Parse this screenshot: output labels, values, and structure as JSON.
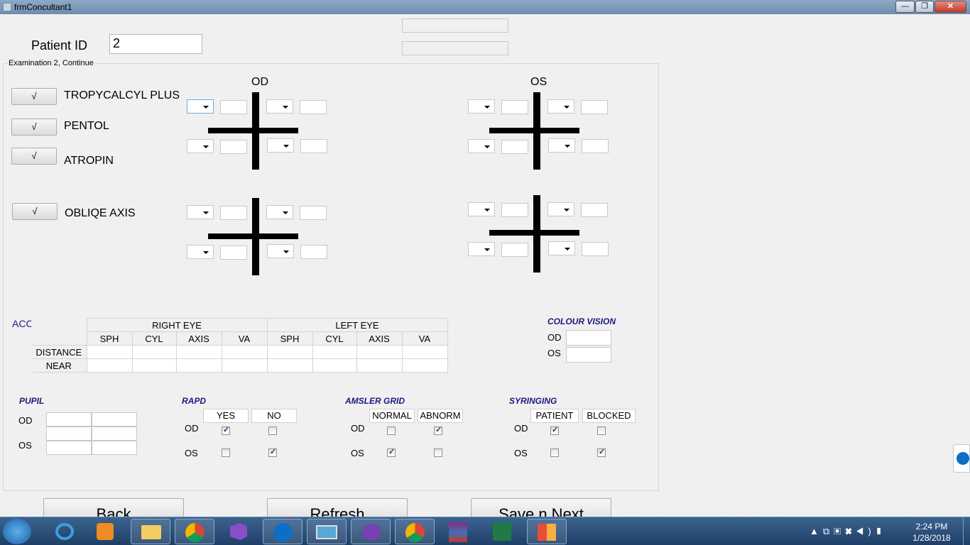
{
  "window": {
    "title": "frmConcultant1",
    "min": "—",
    "max": "❐",
    "close": "✕"
  },
  "patient": {
    "label": "Patient ID",
    "value": "2"
  },
  "group_label": "Examination 2, Continue",
  "od_label": "OD",
  "os_label": "OS",
  "drugs": [
    {
      "check": "√",
      "label": "TROPYCALCYL PLUS"
    },
    {
      "check": "√",
      "label": "PENTOL"
    },
    {
      "check": "√",
      "label": "ATROPIN"
    },
    {
      "check": "√",
      "label": "OBLIQE AXIS"
    }
  ],
  "acceptance": {
    "label": "ACCEPTENCE",
    "right_eye": "RIGHT EYE",
    "left_eye": "LEFT EYE",
    "columns": [
      "SPH",
      "CYL",
      "AXIS",
      "VA",
      "SPH",
      "CYL",
      "AXIS",
      "VA"
    ],
    "rows": [
      "DISTANCE",
      "NEAR"
    ]
  },
  "colour_vision": {
    "title": "COLOUR VISION",
    "od": "OD",
    "os": "OS"
  },
  "pupil": {
    "title": "PUPIL",
    "od": "OD",
    "os": "OS"
  },
  "rapd": {
    "title": "RAPD",
    "col1": "YES",
    "col2": "NO",
    "od": "OD",
    "os": "OS",
    "od_col1": true,
    "od_col2": false,
    "os_col1": false,
    "os_col2": true
  },
  "amsler": {
    "title": "AMSLER GRID",
    "col1": "NORMAL",
    "col2": "ABNORM",
    "od": "OD",
    "os": "OS",
    "od_col1": false,
    "od_col2": true,
    "os_col1": true,
    "os_col2": false
  },
  "syringing": {
    "title": "SYRINGING",
    "col1": "PATIENT",
    "col2": "BLOCKED",
    "od": "OD",
    "os": "OS",
    "od_col1": true,
    "od_col2": false,
    "os_col1": false,
    "os_col2": true
  },
  "buttons": {
    "back": "Back",
    "refresh": "Refresh",
    "save": "Save n Next"
  },
  "clock": {
    "time": "2:24 PM",
    "date": "1/28/2018"
  },
  "taskbar_icons": [
    "ie-icon",
    "media-player-icon",
    "explorer-icon",
    "chrome-icon",
    "visual-studio-icon",
    "teamviewer-icon",
    "photos-icon",
    "visual-studio-alt-icon",
    "chrome-icon",
    "winrar-icon",
    "excel-icon",
    "office-icon"
  ]
}
